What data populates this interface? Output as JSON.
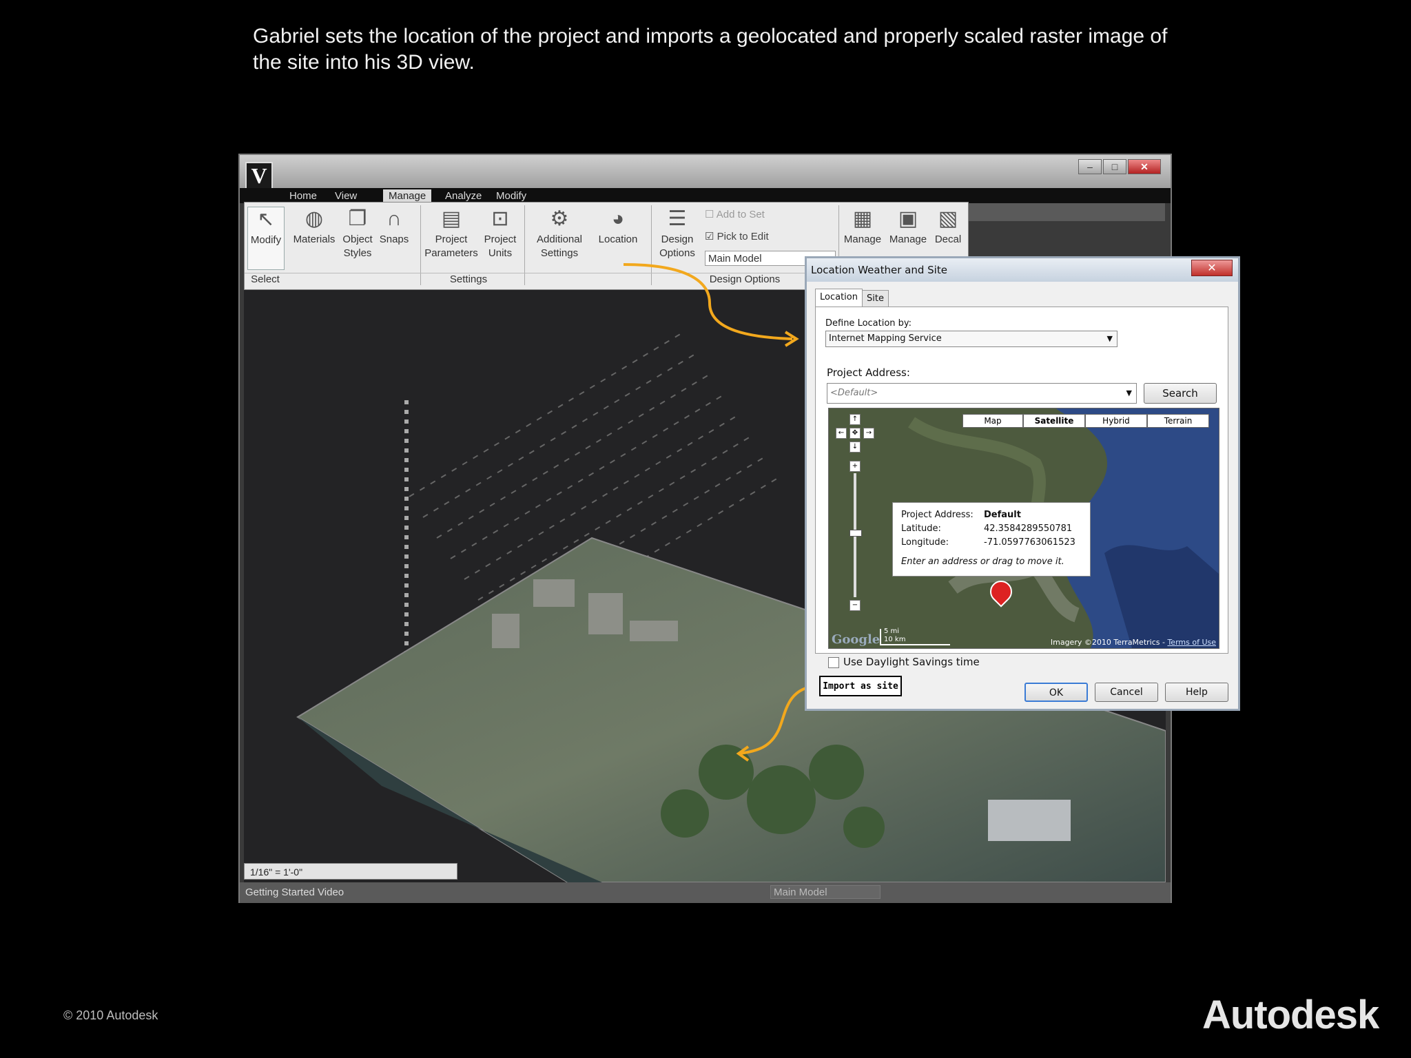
{
  "slide": {
    "caption": "Gabriel sets the location of the project and imports a geolocated and properly scaled raster image of the site into his 3D view.",
    "copyright": "© 2010 Autodesk",
    "brand": "Autodesk"
  },
  "app": {
    "logo_letter": "V",
    "menu_tabs": [
      "Home",
      "View",
      "Manage",
      "Analyze",
      "Modify"
    ],
    "active_tab": "Manage",
    "ribbon": {
      "modify": "Modify",
      "materials": "Materials",
      "object_styles_1": "Object",
      "object_styles_2": "Styles",
      "snaps": "Snaps",
      "project_parameters_1": "Project",
      "project_parameters_2": "Parameters",
      "project_units_1": "Project",
      "project_units_2": "Units",
      "additional_settings_1": "Additional",
      "additional_settings_2": "Settings",
      "location": "Location",
      "design_options_1": "Design",
      "design_options_2": "Options",
      "add_to_set": "Add to Set",
      "pick_to_edit": "Pick to Edit",
      "main_model": "Main Model",
      "manage_1": "Manage",
      "manage_2": "Manage",
      "decal": "Decal",
      "group_select": "Select",
      "group_settings": "Settings",
      "group_design_options": "Design Options"
    },
    "scale_label": "1/16\" = 1'-0\"",
    "status_text": "Getting Started Video",
    "status_model": "Main Model"
  },
  "dialog": {
    "title": "Location Weather and Site",
    "tabs": [
      "Location",
      "Site"
    ],
    "define_location_label": "Define Location by:",
    "define_location_value": "Internet Mapping Service",
    "project_address_label": "Project Address:",
    "project_address_placeholder": "<Default>",
    "search_label": "Search",
    "map_types": [
      "Map",
      "Satellite",
      "Hybrid",
      "Terrain"
    ],
    "selected_map_type": "Satellite",
    "info": {
      "address_label": "Project Address:",
      "address_value": "Default",
      "latitude_label": "Latitude:",
      "latitude_value": "42.3584289550781",
      "longitude_label": "Longitude:",
      "longitude_value": "-71.0597763061523",
      "hint": "Enter an address or drag to move it."
    },
    "map_scale_mi": "5 mi",
    "map_scale_km": "10 km",
    "google_logo": "Google",
    "attribution": "Imagery ©2010 TerraMetrics - ",
    "terms_link": "Terms of Use",
    "daylight_label": "Use Daylight Savings time",
    "daylight_checked": false,
    "import_as_site": "Import as site",
    "ok": "OK",
    "cancel": "Cancel",
    "help": "Help"
  },
  "colors": {
    "accent_arrow": "#f2a81d",
    "background": "#000000"
  }
}
